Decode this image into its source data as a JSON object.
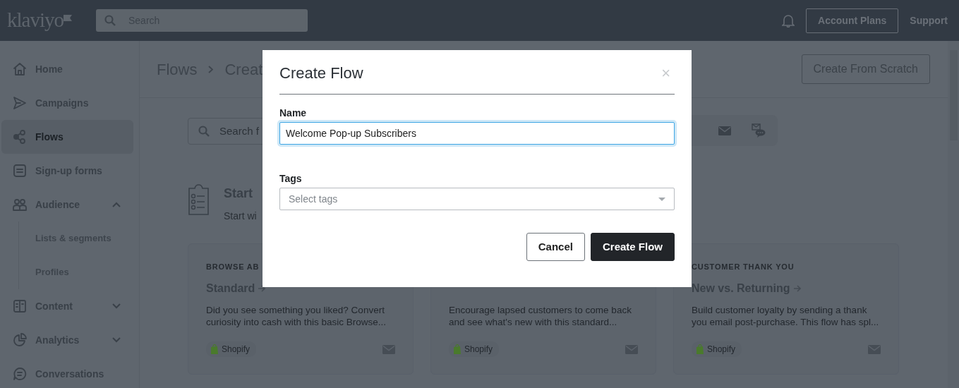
{
  "topbar": {
    "logo": "klaviyo",
    "search": {
      "placeholder": "Search"
    },
    "buttons": [
      {
        "label": "Account Plans",
        "kind": "outline"
      },
      {
        "label": "Support",
        "kind": "link"
      }
    ]
  },
  "sidebar": {
    "items": [
      {
        "label": "Home",
        "selected": false
      },
      {
        "label": "Campaigns",
        "selected": false
      },
      {
        "label": "Flows",
        "selected": true
      },
      {
        "label": "Sign-up forms",
        "selected": false
      },
      {
        "label": "Audience",
        "selected": false,
        "expanded": true,
        "children": [
          {
            "label": "Lists & segments",
            "selected": false
          },
          {
            "label": "Profiles",
            "selected": false
          }
        ]
      },
      {
        "label": "Content",
        "selected": false,
        "expanded": false
      },
      {
        "label": "Analytics",
        "selected": false,
        "expanded": false
      },
      {
        "label": "Conversations",
        "selected": false
      }
    ]
  },
  "header": {
    "breadcrumb": [
      "Flows",
      "Creat"
    ],
    "button": "Create From Scratch"
  },
  "filters": {
    "search": {
      "placeholder": "Search f"
    }
  },
  "start": {
    "title": "Start",
    "subtitle": "Start wi"
  },
  "cards": [
    {
      "category": "BROWSE AB",
      "title": "Standard",
      "description": "Did you see something you liked? Convert curiosity into cash with this basic Browse...",
      "tag": "Shopify"
    },
    {
      "description": "Encourage lapsed customers to come back and see what's new with this standard...",
      "tag": "Shopify"
    },
    {
      "category": "CUSTOMER THANK YOU",
      "title": "New vs. Returning",
      "description": "Build customer loyalty by sending a thank you email post-purchase. This flow has spl...",
      "tag": "Shopify"
    }
  ],
  "modal": {
    "title": "Create Flow",
    "close": "×",
    "fields": [
      {
        "kind": "text",
        "label": "Name",
        "value": "Welcome Pop-up Subscribers",
        "focused": true
      },
      {
        "kind": "select",
        "label": "Tags",
        "placeholder": "Select tags"
      }
    ],
    "buttons": [
      {
        "label": "Cancel",
        "kind": "secondary"
      },
      {
        "label": "Create Flow",
        "kind": "primary"
      }
    ]
  }
}
